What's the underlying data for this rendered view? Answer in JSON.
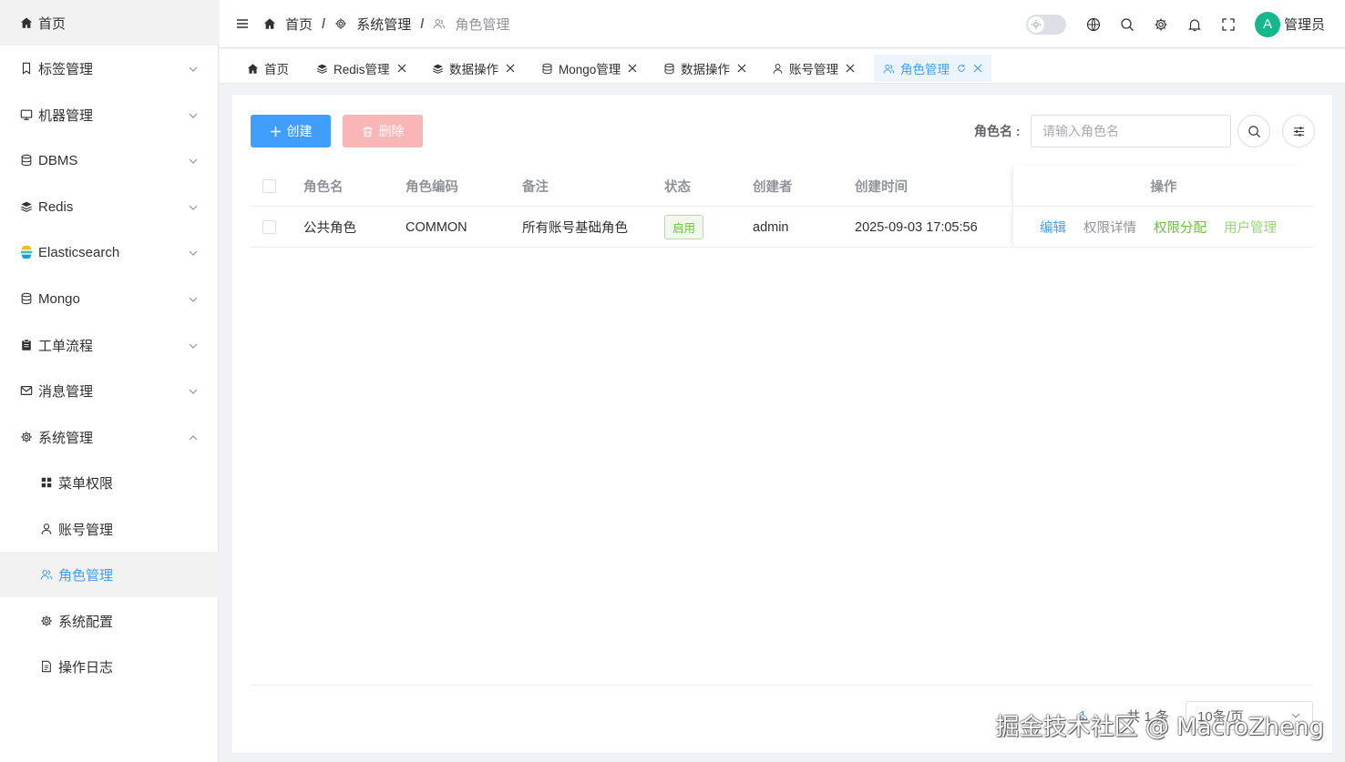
{
  "sidebar": {
    "items": [
      {
        "label": "首页",
        "icon": "home-icon"
      },
      {
        "label": "标签管理",
        "icon": "bookmark-icon"
      },
      {
        "label": "机器管理",
        "icon": "monitor-icon"
      },
      {
        "label": "DBMS",
        "icon": "database-icon"
      },
      {
        "label": "Redis",
        "icon": "layers-icon"
      },
      {
        "label": "Elasticsearch",
        "icon": "elasticsearch-icon"
      },
      {
        "label": "Mongo",
        "icon": "database-icon"
      },
      {
        "label": "工单流程",
        "icon": "clipboard-icon"
      },
      {
        "label": "消息管理",
        "icon": "mail-icon"
      },
      {
        "label": "系统管理",
        "icon": "gear-icon"
      }
    ],
    "sub_items": [
      {
        "label": "菜单权限",
        "icon": "grid-icon"
      },
      {
        "label": "账号管理",
        "icon": "user-icon"
      },
      {
        "label": "角色管理",
        "icon": "users-icon"
      },
      {
        "label": "系统配置",
        "icon": "gear-icon"
      },
      {
        "label": "操作日志",
        "icon": "document-icon"
      }
    ]
  },
  "breadcrumb": {
    "items": [
      "首页",
      "系统管理",
      "角色管理"
    ],
    "separator": "/"
  },
  "header": {
    "username": "管理员",
    "avatar_letter": "A"
  },
  "tabs": [
    {
      "label": "首页",
      "icon": "home-icon",
      "closable": false
    },
    {
      "label": "Redis管理",
      "icon": "layers-icon",
      "closable": true
    },
    {
      "label": "数据操作",
      "icon": "layers-icon",
      "closable": true
    },
    {
      "label": "Mongo管理",
      "icon": "database-icon",
      "closable": true
    },
    {
      "label": "数据操作",
      "icon": "database-icon",
      "closable": true
    },
    {
      "label": "账号管理",
      "icon": "user-icon",
      "closable": true
    },
    {
      "label": "角色管理",
      "icon": "users-icon",
      "closable": true,
      "active": true
    }
  ],
  "toolbar": {
    "create_label": "创建",
    "delete_label": "删除",
    "search_label": "角色名 :",
    "search_placeholder": "请输入角色名"
  },
  "table": {
    "columns": [
      "角色名",
      "角色编码",
      "备注",
      "状态",
      "创建者",
      "创建时间",
      "操作"
    ],
    "rows": [
      {
        "name": "公共角色",
        "code": "COMMON",
        "remark": "所有账号基础角色",
        "status": "启用",
        "creator": "admin",
        "created_at": "2025-09-03 17:05:56",
        "actions": [
          "编辑",
          "权限详情",
          "权限分配",
          "用户管理"
        ]
      }
    ]
  },
  "pagination": {
    "current_page": "1",
    "total_text": "共 1 条",
    "page_size": "10条/页"
  },
  "watermark": "掘金技术社区 @ MacroZheng",
  "colors": {
    "primary": "#409eff",
    "danger_light": "#fab6b6",
    "success": "#67c23a",
    "success_light": "#95d475",
    "avatar": "#13b88b"
  }
}
